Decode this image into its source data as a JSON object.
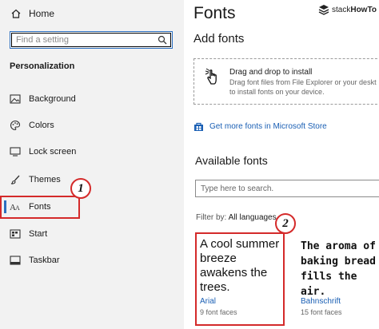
{
  "sidebar": {
    "home_label": "Home",
    "search_placeholder": "Find a setting",
    "section_title": "Personalization",
    "items": [
      {
        "label": "Background",
        "icon": "image-icon"
      },
      {
        "label": "Colors",
        "icon": "palette-icon"
      },
      {
        "label": "Lock screen",
        "icon": "lock-screen-icon"
      },
      {
        "label": "Themes",
        "icon": "brush-icon"
      },
      {
        "label": "Fonts",
        "icon": "fonts-icon",
        "active": true
      },
      {
        "label": "Start",
        "icon": "start-icon"
      },
      {
        "label": "Taskbar",
        "icon": "taskbar-icon"
      }
    ]
  },
  "callouts": {
    "one": "1",
    "two": "2"
  },
  "logo": {
    "stack": "stack",
    "howto": "HowTo"
  },
  "main": {
    "title": "Fonts",
    "add_title": "Add fonts",
    "drop_title": "Drag and drop to install",
    "drop_line_1": "Drag font files from File Explorer or your deskt",
    "drop_line_2": "to install fonts on your device.",
    "store_link": "Get more fonts in Microsoft Store",
    "available_title": "Available fonts",
    "font_search_placeholder": "Type here to search.",
    "filter_label": "Filter by:",
    "filter_value": "All languages",
    "fonts": [
      {
        "sample": "A cool summer breeze awakens the trees.",
        "name": "Arial",
        "faces": "9 font faces"
      },
      {
        "sample": "The aroma of baking bread fills the air.",
        "name": "Bahnschrift",
        "faces": "15 font faces"
      }
    ]
  },
  "colors": {
    "accent": "#2b6fc0",
    "highlight": "#d42a2a",
    "link": "#1a5fb4"
  }
}
